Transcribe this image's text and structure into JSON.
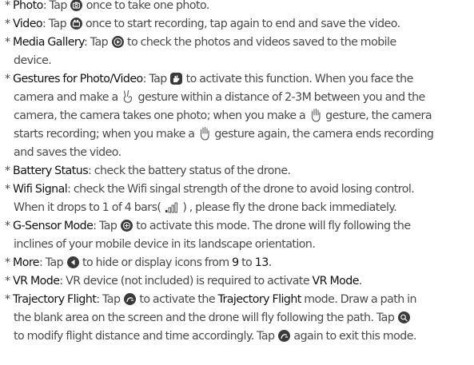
{
  "icons": {
    "camera": "camera-icon",
    "video": "video-icon",
    "gallery": "media-gallery-icon",
    "gesture": "gesture-icon",
    "victory_hand": "victory-hand-icon",
    "open_palm": "open-palm-icon",
    "signal": "signal-bars-icon",
    "gsensor": "g-sensor-icon",
    "more": "more-arrow-icon",
    "trajectory": "trajectory-flight-icon",
    "trajectory_settings": "trajectory-settings-icon"
  },
  "items": [
    {
      "term": "Photo",
      "l1": {
        "pre": ": Tap ",
        "post": " once to take one photo."
      }
    },
    {
      "term": "Video",
      "l1": {
        "pre": ": Tap ",
        "post": " once to start recording, tap again to end and save the video."
      }
    },
    {
      "term": "Media Gallery",
      "l1": {
        "pre": ": Tap ",
        "post": " to check the photos and videos saved to the mobile"
      },
      "l2": "device."
    },
    {
      "term": "Gestures for Photo/Video",
      "l1": {
        "pre": ": Tap ",
        "post": " to activate this function. When you face the"
      },
      "l2": {
        "pre": "camera and make a ",
        "post": " gesture within a distance of 2-3M between you and the"
      },
      "l3": {
        "pre": "camera, the camera takes one photo; when you make a ",
        "post": " gesture, the camera"
      },
      "l4": {
        "pre": "starts recording; when you make a ",
        "post": " gesture again, the camera ends recording"
      },
      "l5": "and saves the video."
    },
    {
      "term": "Battery Status",
      "l1": ": check the battery status of the drone."
    },
    {
      "term": "Wifi Signal",
      "l1": ": check the Wifi singal strength of the drone to avoid losing control.",
      "l2": {
        "pre": "When it drops to 1 of 4 bars( ",
        "post": " ) , please fly the drone back immediately."
      }
    },
    {
      "term": "G-Sensor Mode",
      "l1": {
        "pre": ": Tap ",
        "post": " to activate this mode. The drone will fly following the"
      },
      "l2": "inclines of  your mobile device in its landscape orientation."
    },
    {
      "term": "More",
      "l1": {
        "pre": ":  Tap ",
        "mid": " to hide or display icons from ",
        "num1": "9",
        "to": " to ",
        "num2": "13",
        "end": "."
      }
    },
    {
      "term": "VR Mode",
      "l1": {
        "pre": ":  VR device (not included) is required to activate ",
        "term2": "VR Mode",
        "end": "."
      }
    },
    {
      "term": "Trajectory Flight",
      "l1": {
        "pre": ": Tap ",
        "mid": " to activate the ",
        "term2": "Trajectory Flight",
        "post": " mode. Draw a path in"
      },
      "l2": {
        "pre": "the blank area on the screen and the drone will fly following the path. Tap "
      },
      "l3": {
        "pre": "to modify flight distance and time accordingly. Tap ",
        "post": " again to exit this mode."
      }
    }
  ]
}
